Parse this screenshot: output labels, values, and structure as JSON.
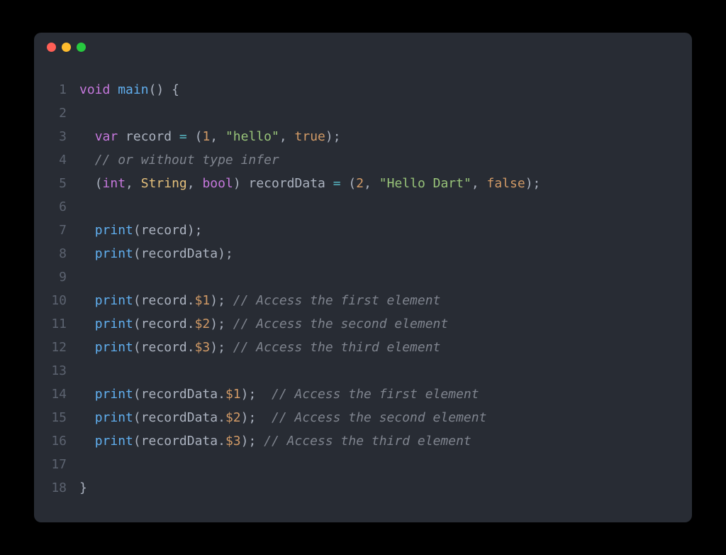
{
  "colors": {
    "background": "#282C34",
    "keyword": "#C678DD",
    "function": "#61AFEF",
    "variable": "#E5C07B",
    "operator": "#56B6C2",
    "number": "#D19A66",
    "string": "#98C379",
    "comment": "#7F848E",
    "plain": "#ABB2BF",
    "gutter": "#5C6370"
  },
  "window": {
    "traffic_lights": [
      "red",
      "yellow",
      "green"
    ]
  },
  "lines": [
    {
      "n": "1",
      "tokens": [
        {
          "c": "kw",
          "t": "void"
        },
        {
          "c": "plain",
          "t": " "
        },
        {
          "c": "func",
          "t": "main"
        },
        {
          "c": "paren",
          "t": "()"
        },
        {
          "c": "plain",
          "t": " "
        },
        {
          "c": "paren",
          "t": "{"
        }
      ]
    },
    {
      "n": "2",
      "tokens": []
    },
    {
      "n": "3",
      "tokens": [
        {
          "c": "plain",
          "t": "  "
        },
        {
          "c": "kw",
          "t": "var"
        },
        {
          "c": "plain",
          "t": " "
        },
        {
          "c": "plain",
          "t": "record "
        },
        {
          "c": "op",
          "t": "="
        },
        {
          "c": "plain",
          "t": " "
        },
        {
          "c": "paren",
          "t": "("
        },
        {
          "c": "num",
          "t": "1"
        },
        {
          "c": "plain",
          "t": ", "
        },
        {
          "c": "str",
          "t": "\"hello\""
        },
        {
          "c": "plain",
          "t": ", "
        },
        {
          "c": "bool",
          "t": "true"
        },
        {
          "c": "paren",
          "t": ")"
        },
        {
          "c": "plain",
          "t": ";"
        }
      ]
    },
    {
      "n": "4",
      "tokens": [
        {
          "c": "plain",
          "t": "  "
        },
        {
          "c": "comment",
          "t": "// or without type infer"
        }
      ]
    },
    {
      "n": "5",
      "tokens": [
        {
          "c": "plain",
          "t": "  "
        },
        {
          "c": "paren",
          "t": "("
        },
        {
          "c": "type",
          "t": "int"
        },
        {
          "c": "plain",
          "t": ", "
        },
        {
          "c": "var",
          "t": "String"
        },
        {
          "c": "plain",
          "t": ", "
        },
        {
          "c": "type",
          "t": "bool"
        },
        {
          "c": "paren",
          "t": ")"
        },
        {
          "c": "plain",
          "t": " recordData "
        },
        {
          "c": "op",
          "t": "="
        },
        {
          "c": "plain",
          "t": " "
        },
        {
          "c": "paren",
          "t": "("
        },
        {
          "c": "num",
          "t": "2"
        },
        {
          "c": "plain",
          "t": ", "
        },
        {
          "c": "str",
          "t": "\"Hello Dart\""
        },
        {
          "c": "plain",
          "t": ", "
        },
        {
          "c": "bool",
          "t": "false"
        },
        {
          "c": "paren",
          "t": ")"
        },
        {
          "c": "plain",
          "t": ";"
        }
      ]
    },
    {
      "n": "6",
      "tokens": []
    },
    {
      "n": "7",
      "tokens": [
        {
          "c": "plain",
          "t": "  "
        },
        {
          "c": "call",
          "t": "print"
        },
        {
          "c": "paren",
          "t": "("
        },
        {
          "c": "plain",
          "t": "record"
        },
        {
          "c": "paren",
          "t": ")"
        },
        {
          "c": "plain",
          "t": ";"
        }
      ]
    },
    {
      "n": "8",
      "tokens": [
        {
          "c": "plain",
          "t": "  "
        },
        {
          "c": "call",
          "t": "print"
        },
        {
          "c": "paren",
          "t": "("
        },
        {
          "c": "plain",
          "t": "recordData"
        },
        {
          "c": "paren",
          "t": ")"
        },
        {
          "c": "plain",
          "t": ";"
        }
      ]
    },
    {
      "n": "9",
      "tokens": []
    },
    {
      "n": "10",
      "tokens": [
        {
          "c": "plain",
          "t": "  "
        },
        {
          "c": "call",
          "t": "print"
        },
        {
          "c": "paren",
          "t": "("
        },
        {
          "c": "plain",
          "t": "record."
        },
        {
          "c": "num",
          "t": "$1"
        },
        {
          "c": "paren",
          "t": ")"
        },
        {
          "c": "plain",
          "t": "; "
        },
        {
          "c": "comment",
          "t": "// Access the first element"
        }
      ]
    },
    {
      "n": "11",
      "tokens": [
        {
          "c": "plain",
          "t": "  "
        },
        {
          "c": "call",
          "t": "print"
        },
        {
          "c": "paren",
          "t": "("
        },
        {
          "c": "plain",
          "t": "record."
        },
        {
          "c": "num",
          "t": "$2"
        },
        {
          "c": "paren",
          "t": ")"
        },
        {
          "c": "plain",
          "t": "; "
        },
        {
          "c": "comment",
          "t": "// Access the second element"
        }
      ]
    },
    {
      "n": "12",
      "tokens": [
        {
          "c": "plain",
          "t": "  "
        },
        {
          "c": "call",
          "t": "print"
        },
        {
          "c": "paren",
          "t": "("
        },
        {
          "c": "plain",
          "t": "record."
        },
        {
          "c": "num",
          "t": "$3"
        },
        {
          "c": "paren",
          "t": ")"
        },
        {
          "c": "plain",
          "t": "; "
        },
        {
          "c": "comment",
          "t": "// Access the third element"
        }
      ]
    },
    {
      "n": "13",
      "tokens": []
    },
    {
      "n": "14",
      "tokens": [
        {
          "c": "plain",
          "t": "  "
        },
        {
          "c": "call",
          "t": "print"
        },
        {
          "c": "paren",
          "t": "("
        },
        {
          "c": "plain",
          "t": "recordData."
        },
        {
          "c": "num",
          "t": "$1"
        },
        {
          "c": "paren",
          "t": ")"
        },
        {
          "c": "plain",
          "t": ";  "
        },
        {
          "c": "comment",
          "t": "// Access the first element"
        }
      ]
    },
    {
      "n": "15",
      "tokens": [
        {
          "c": "plain",
          "t": "  "
        },
        {
          "c": "call",
          "t": "print"
        },
        {
          "c": "paren",
          "t": "("
        },
        {
          "c": "plain",
          "t": "recordData."
        },
        {
          "c": "num",
          "t": "$2"
        },
        {
          "c": "paren",
          "t": ")"
        },
        {
          "c": "plain",
          "t": ";  "
        },
        {
          "c": "comment",
          "t": "// Access the second element"
        }
      ]
    },
    {
      "n": "16",
      "tokens": [
        {
          "c": "plain",
          "t": "  "
        },
        {
          "c": "call",
          "t": "print"
        },
        {
          "c": "paren",
          "t": "("
        },
        {
          "c": "plain",
          "t": "recordData."
        },
        {
          "c": "num",
          "t": "$3"
        },
        {
          "c": "paren",
          "t": ")"
        },
        {
          "c": "plain",
          "t": "; "
        },
        {
          "c": "comment",
          "t": "// Access the third element"
        }
      ]
    },
    {
      "n": "17",
      "tokens": []
    },
    {
      "n": "18",
      "tokens": [
        {
          "c": "paren",
          "t": "}"
        }
      ]
    }
  ]
}
